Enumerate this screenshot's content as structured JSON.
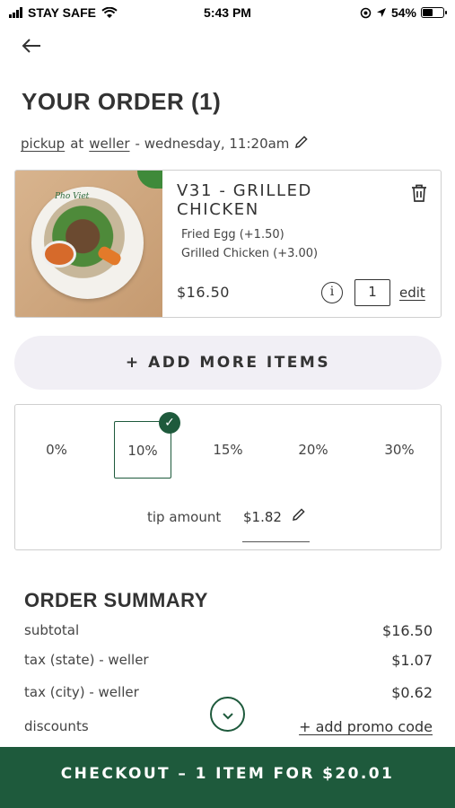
{
  "status_bar": {
    "carrier": "STAY SAFE",
    "time": "5:43 PM",
    "battery": "54%",
    "battery_level": 0.54
  },
  "header": {
    "title": "YOUR ORDER (1)"
  },
  "pickup": {
    "mode": "pickup",
    "at": "at",
    "location": "weller",
    "time": "- wednesday, 11:20am"
  },
  "item": {
    "image_logo": "Pho Viet",
    "name": "V31 - GRILLED CHICKEN",
    "modifiers": [
      "Fried Egg (+1.50)",
      "Grilled Chicken (+3.00)"
    ],
    "price": "$16.50",
    "info": "i",
    "quantity": "1",
    "edit_label": "edit"
  },
  "add_more_label": "+ ADD MORE ITEMS",
  "tip": {
    "options": [
      "0%",
      "10%",
      "15%",
      "20%",
      "30%"
    ],
    "selected": "10%",
    "label": "tip amount",
    "amount": "$1.82"
  },
  "summary": {
    "title": "ORDER SUMMARY",
    "rows": [
      {
        "label": "subtotal",
        "value": "$16.50"
      },
      {
        "label": "tax (state) - weller",
        "value": "$1.07"
      },
      {
        "label": "tax (city) - weller",
        "value": "$0.62"
      },
      {
        "label": "discounts",
        "value": "+ add promo code"
      }
    ]
  },
  "checkout_label": "CHECKOUT – 1 ITEM FOR $20.01",
  "colors": {
    "brand_green": "#1e5a3c",
    "add_more_bg": "#f1eff5"
  },
  "icons": [
    "wifi-icon",
    "location-icon",
    "arrow-icon",
    "back-arrow-icon",
    "pencil-icon",
    "trash-icon",
    "info-icon",
    "check-icon",
    "chevron-down-icon"
  ]
}
